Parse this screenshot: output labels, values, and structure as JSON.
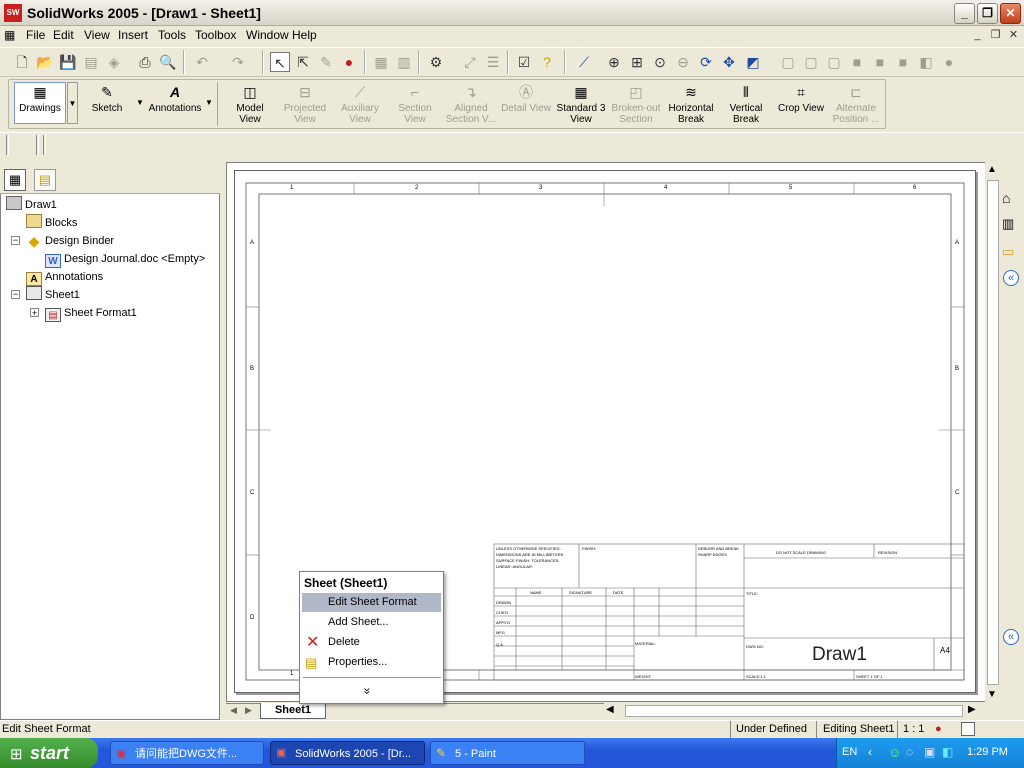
{
  "window": {
    "title": "SolidWorks 2005 - [Draw1 - Sheet1]",
    "minimize": "_",
    "restore": "❐",
    "close": "✕"
  },
  "menubar": {
    "items": [
      "File",
      "Edit",
      "View",
      "Insert",
      "Tools",
      "Toolbox",
      "Window",
      "Help"
    ]
  },
  "command_manager": {
    "groups": [
      {
        "label": "Drawings"
      },
      {
        "label": "Sketch"
      },
      {
        "label": "Annotations"
      }
    ],
    "buttons": [
      {
        "label": "Model View",
        "enabled": true,
        "icon": "model-view"
      },
      {
        "label": "Projected View",
        "enabled": false,
        "icon": "projected-view"
      },
      {
        "label": "Auxiliary View",
        "enabled": false,
        "icon": "auxiliary-view"
      },
      {
        "label": "Section View",
        "enabled": false,
        "icon": "section-view"
      },
      {
        "label": "Aligned Section V...",
        "enabled": false,
        "icon": "aligned-section-view"
      },
      {
        "label": "Detail View",
        "enabled": false,
        "icon": "detail-view"
      },
      {
        "label": "Standard 3 View",
        "enabled": true,
        "icon": "standard-3-view"
      },
      {
        "label": "Broken-out Section",
        "enabled": false,
        "icon": "broken-out-section"
      },
      {
        "label": "Horizontal Break",
        "enabled": true,
        "icon": "horizontal-break"
      },
      {
        "label": "Vertical Break",
        "enabled": true,
        "icon": "vertical-break"
      },
      {
        "label": "Crop View",
        "enabled": true,
        "icon": "crop-view"
      },
      {
        "label": "Alternate Position ...",
        "enabled": false,
        "icon": "alternate-position"
      }
    ]
  },
  "tree": {
    "items": [
      {
        "label": "Draw1",
        "icon": "drawing-icon"
      },
      {
        "label": "Blocks",
        "icon": "folder-icon"
      },
      {
        "label": "Design Binder",
        "icon": "binder-icon"
      },
      {
        "label": "Design Journal.doc <Empty>",
        "icon": "word-doc-icon"
      },
      {
        "label": "Annotations",
        "icon": "annotations-icon"
      },
      {
        "label": "Sheet1",
        "icon": "sheet-icon"
      },
      {
        "label": "Sheet Format1",
        "icon": "sheet-format-icon"
      }
    ]
  },
  "drawing": {
    "col_numbers": [
      "1",
      "2",
      "3",
      "4",
      "5",
      "6"
    ],
    "row_letters": [
      "A",
      "B",
      "C",
      "D"
    ],
    "title_block": {
      "notes": "UNLESS OTHERWISE SPECIFIED: DIMENSIONS ARE IN MILLIMETERS SURFACE FINISH: TOLERANCES: LINEAR: ANGULAR:",
      "finish": "FINISH:",
      "deburr": "DEBURR AND BREAK SHARP EDGES",
      "do_not_scale": "DO NOT SCALE DRAWING",
      "revision": "REVISION",
      "name": "NAME",
      "signature": "SIGNATURE",
      "date": "DATE",
      "title": "TITLE:",
      "rows": [
        "DRAWN",
        "CHK'D",
        "APPV'D",
        "MFG",
        "Q.A"
      ],
      "material": "MATERIAL:",
      "dwg_no": "DWG NO.",
      "drawing_name": "Draw1",
      "size": "A4",
      "weight": "WEIGHT:",
      "scale": "SCALE:1:1",
      "sheet": "SHEET 1 OF 1"
    }
  },
  "sheet_tab": "Sheet1",
  "context_menu": {
    "header": "Sheet (Sheet1)",
    "items": [
      {
        "label": "Edit Sheet Format",
        "highlighted": true,
        "icon": ""
      },
      {
        "label": "Add Sheet...",
        "highlighted": false,
        "icon": ""
      },
      {
        "label": "Delete",
        "highlighted": false,
        "icon": "delete-x-icon"
      },
      {
        "label": "Properties...",
        "highlighted": false,
        "icon": "properties-icon"
      }
    ],
    "more": "»"
  },
  "statusbar": {
    "message": "Edit Sheet Format",
    "state": "Under Defined",
    "editing": "Editing Sheet1",
    "scale": "1 : 1"
  },
  "taskbar": {
    "start": "start",
    "buttons": [
      {
        "label": "请问能把DWG文件..."
      },
      {
        "label": "SolidWorks 2005 - [Dr..."
      },
      {
        "label": "5 - Paint"
      }
    ],
    "lang": "EN",
    "time": "1:29 PM"
  },
  "colors": {
    "accent": "#2356d8",
    "highlight": "#b0b8c8",
    "start_green": "#368c2d"
  }
}
